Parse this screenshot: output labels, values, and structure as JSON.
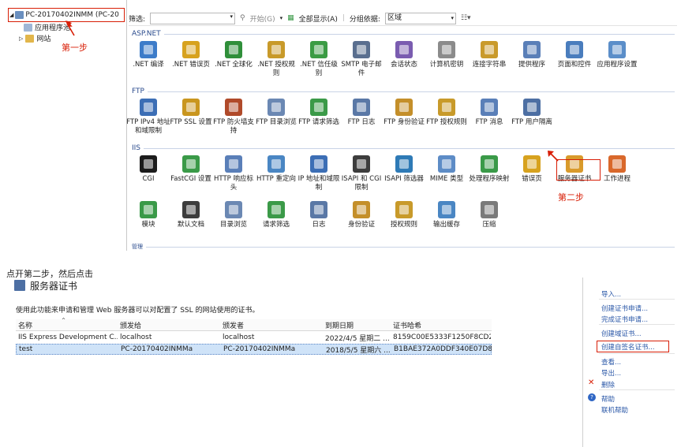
{
  "tree": {
    "root_label": "PC-20170402INMM (PC-20",
    "children": [
      "应用程序池",
      "网站"
    ],
    "step1": "第一步"
  },
  "toolbar": {
    "filter_label": "筛选:",
    "start_label": "开始(G)",
    "showall_label": "全部显示(A)",
    "group_label": "分组依据:",
    "group_value": "区域"
  },
  "sections": {
    "aspnet": "ASP.NET",
    "ftp": "FTP",
    "iis": "IIS",
    "mgmt": "管理"
  },
  "aspnet_features": [
    {
      "label": ".NET 编译",
      "color": "#3d7cc9"
    },
    {
      "label": ".NET 错误页",
      "color": "#d7a21e"
    },
    {
      "label": ".NET 全球化",
      "color": "#2f8f3a"
    },
    {
      "label": ".NET 授权规则",
      "color": "#c89a2a"
    },
    {
      "label": ".NET 信任级别",
      "color": "#3b9c44"
    },
    {
      "label": "SMTP 电子邮件",
      "color": "#5a6f8f"
    },
    {
      "label": "会话状态",
      "color": "#7a5cb0"
    },
    {
      "label": "计算机密钥",
      "color": "#8b8b8b"
    },
    {
      "label": "连接字符串",
      "color": "#c99a2b"
    },
    {
      "label": "提供程序",
      "color": "#5a7fb8"
    },
    {
      "label": "页面和控件",
      "color": "#4a7dbd"
    },
    {
      "label": "应用程序设置",
      "color": "#5b8ec9"
    }
  ],
  "ftp_features": [
    {
      "label": "FTP IPv4 地址和域限制",
      "color": "#3c6eb5"
    },
    {
      "label": "FTP SSL 设置",
      "color": "#c9961f"
    },
    {
      "label": "FTP 防火墙支持",
      "color": "#b04a2a"
    },
    {
      "label": "FTP 目录浏览",
      "color": "#6b88b3"
    },
    {
      "label": "FTP 请求筛选",
      "color": "#3b9a48"
    },
    {
      "label": "FTP 日志",
      "color": "#5a78a6"
    },
    {
      "label": "FTP 身份验证",
      "color": "#c48f2a"
    },
    {
      "label": "FTP 授权规则",
      "color": "#c89a2a"
    },
    {
      "label": "FTP 消息",
      "color": "#5a7fb8"
    },
    {
      "label": "FTP 用户隔离",
      "color": "#4d6fa3"
    }
  ],
  "iis_features": [
    {
      "label": "CGI",
      "color": "#1c1c1c"
    },
    {
      "label": "FastCGI 设置",
      "color": "#3a9a48"
    },
    {
      "label": "HTTP 响应标头",
      "color": "#5a7fb8"
    },
    {
      "label": "HTTP 重定向",
      "color": "#4a86c3"
    },
    {
      "label": "IP 地址和域限制",
      "color": "#3c6eb5"
    },
    {
      "label": "ISAPI 和 CGI 限制",
      "color": "#3d3d3d"
    },
    {
      "label": "ISAPI 筛选器",
      "color": "#2e7ab6"
    },
    {
      "label": "MIME 类型",
      "color": "#5d8cc6"
    },
    {
      "label": "处理程序映射",
      "color": "#3a9a48"
    },
    {
      "label": "错误页",
      "color": "#d7a21e"
    },
    {
      "label": "服务器证书",
      "color": "#d99a2b"
    },
    {
      "label": "工作进程",
      "color": "#d9682b"
    }
  ],
  "iis_features_row2": [
    {
      "label": "模块",
      "color": "#3a9a48"
    },
    {
      "label": "默认文档",
      "color": "#3d3d3d"
    },
    {
      "label": "目录浏览",
      "color": "#6b88b3"
    },
    {
      "label": "请求筛选",
      "color": "#3b9a48"
    },
    {
      "label": "日志",
      "color": "#5a78a6"
    },
    {
      "label": "身份验证",
      "color": "#c48f2a"
    },
    {
      "label": "授权规则",
      "color": "#c89a2a"
    },
    {
      "label": "输出缓存",
      "color": "#4a86c3"
    },
    {
      "label": "压缩",
      "color": "#7a7a7a"
    }
  ],
  "step2": "第二步",
  "instruction": "点开第二步，然后点击",
  "cert_panel": {
    "title": "服务器证书",
    "description": "使用此功能来申请和管理 Web 服务器可以对配置了 SSL 的网站使用的证书。",
    "columns": [
      "名称",
      "颁发给",
      "颁发者",
      "到期日期",
      "证书哈希"
    ],
    "rows": [
      [
        "IIS Express Development C...",
        "localhost",
        "localhost",
        "2022/4/5 星期二 ...",
        "8159C00E5333F1250F8CD2..."
      ],
      [
        "test",
        "PC-20170402INMMa",
        "PC-20170402INMMa",
        "2018/5/5 星期六 ...",
        "B1BAE372A0DDF340E07D8..."
      ]
    ]
  },
  "actions": {
    "import": "导入...",
    "create_request": "创建证书申请...",
    "complete_request": "完成证书申请...",
    "create_domain": "创建域证书...",
    "create_selfsigned": "创建自签名证书...",
    "view": "查看...",
    "export": "导出...",
    "delete": "删除",
    "help": "帮助",
    "online_help": "联机帮助"
  }
}
